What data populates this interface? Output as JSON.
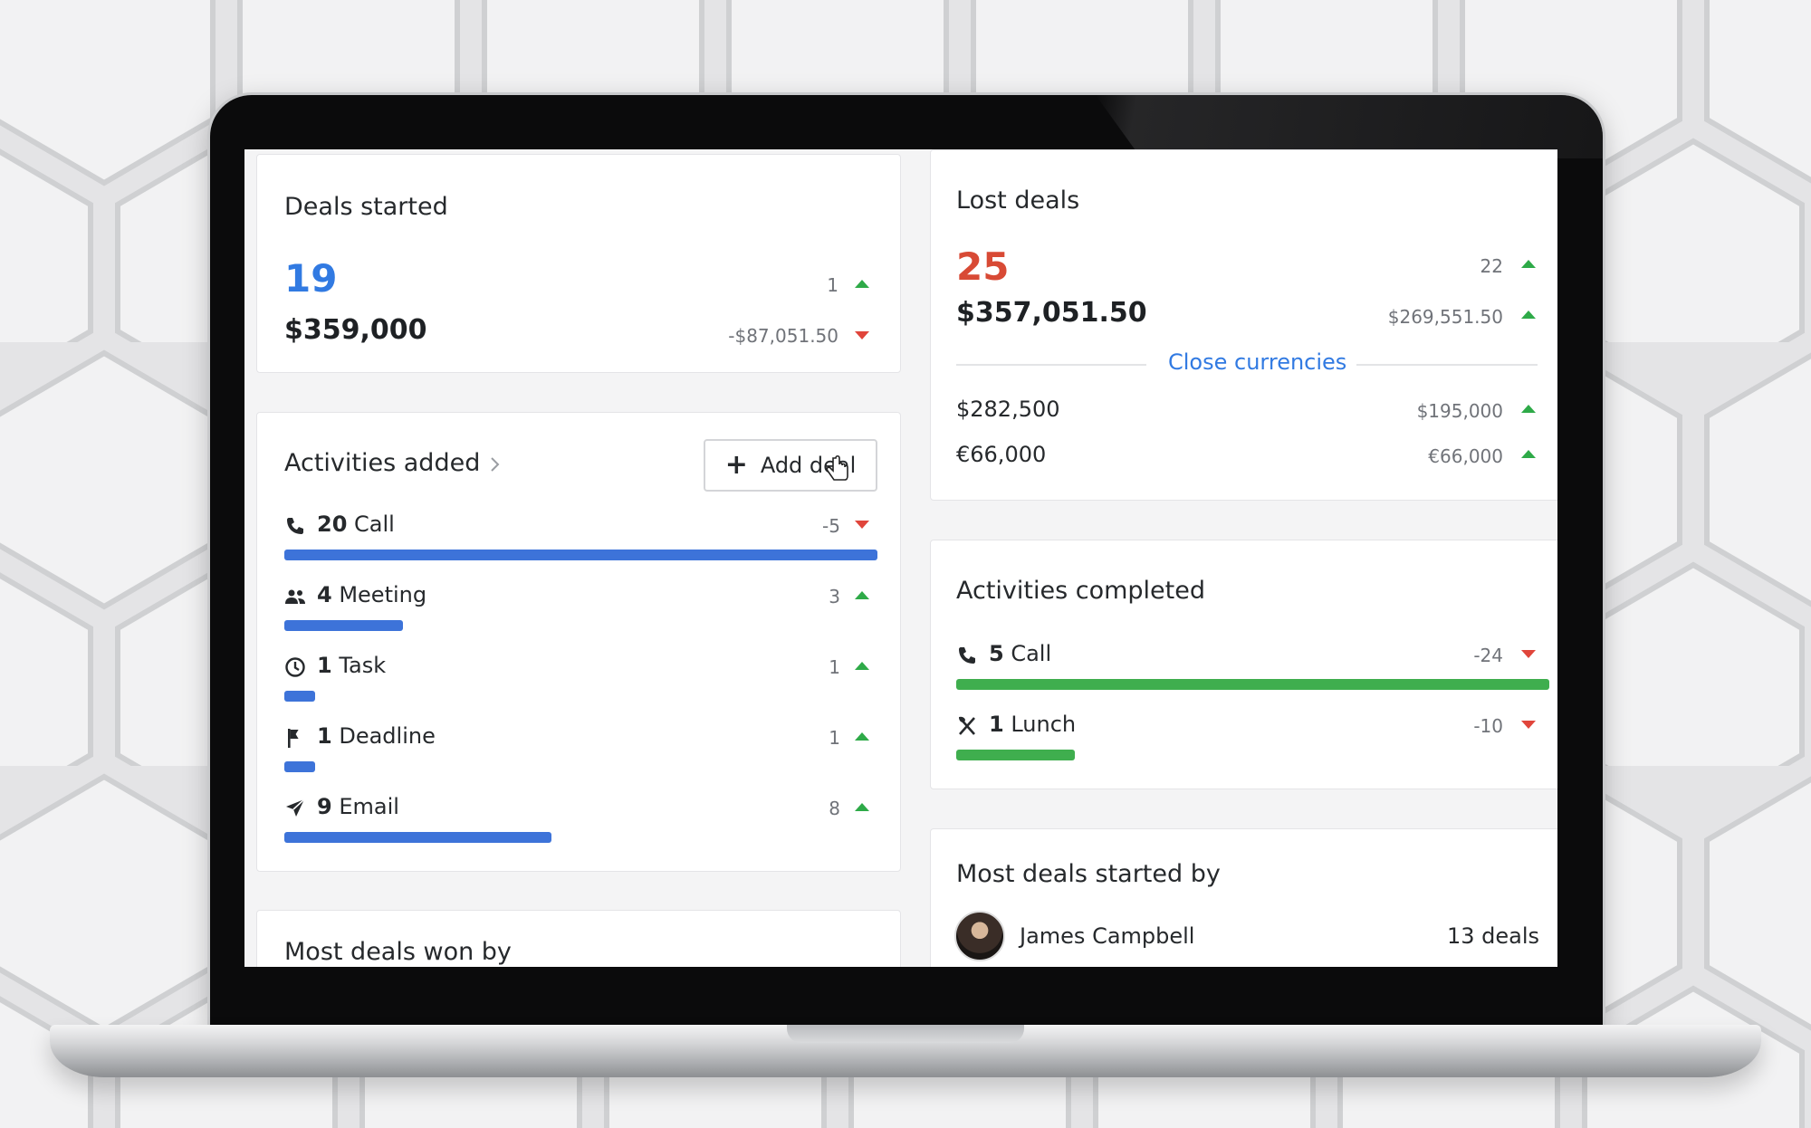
{
  "colors": {
    "blue": "#317ae2",
    "red": "#e0453b",
    "green": "#2eaa48",
    "bar_blue": "#3d73d9",
    "bar_green": "#3fae4e"
  },
  "deals_started": {
    "title": "Deals started",
    "count": "19",
    "count_delta": "1",
    "amount": "$359,000",
    "amount_delta": "-$87,051.50"
  },
  "activities_added": {
    "title": "Activities added",
    "chevron_icon": "chevron-right-icon",
    "add_button": "Add deal",
    "items": [
      {
        "icon": "phone-icon",
        "count": "20",
        "label": "Call",
        "delta": "-5",
        "trend": "down",
        "level": 1.0
      },
      {
        "icon": "people-icon",
        "count": "4",
        "label": "Meeting",
        "delta": "3",
        "trend": "up",
        "level": 0.2
      },
      {
        "icon": "clock-icon",
        "count": "1",
        "label": "Task",
        "delta": "1",
        "trend": "up",
        "level": 0.05
      },
      {
        "icon": "flag-icon",
        "count": "1",
        "label": "Deadline",
        "delta": "1",
        "trend": "up",
        "level": 0.05
      },
      {
        "icon": "send-icon",
        "count": "9",
        "label": "Email",
        "delta": "8",
        "trend": "up",
        "level": 0.45
      }
    ]
  },
  "most_deals_won": {
    "title": "Most deals won by"
  },
  "lost_deals": {
    "title": "Lost deals",
    "count": "25",
    "count_delta": "22",
    "amount": "$357,051.50",
    "amount_delta": "$269,551.50",
    "close_currencies": "Close currencies",
    "currencies": [
      {
        "value": "$282,500",
        "delta": "$195,000"
      },
      {
        "value": "€66,000",
        "delta": "€66,000"
      }
    ]
  },
  "activities_completed": {
    "title": "Activities completed",
    "items": [
      {
        "icon": "phone-icon",
        "count": "5",
        "label": "Call",
        "delta": "-24",
        "trend": "down",
        "level": 1.0
      },
      {
        "icon": "cutlery-icon",
        "count": "1",
        "label": "Lunch",
        "delta": "-10",
        "trend": "down",
        "level": 0.2
      }
    ]
  },
  "most_deals_started": {
    "title": "Most deals started by",
    "person": "James Campbell",
    "deals": "13 deals"
  }
}
